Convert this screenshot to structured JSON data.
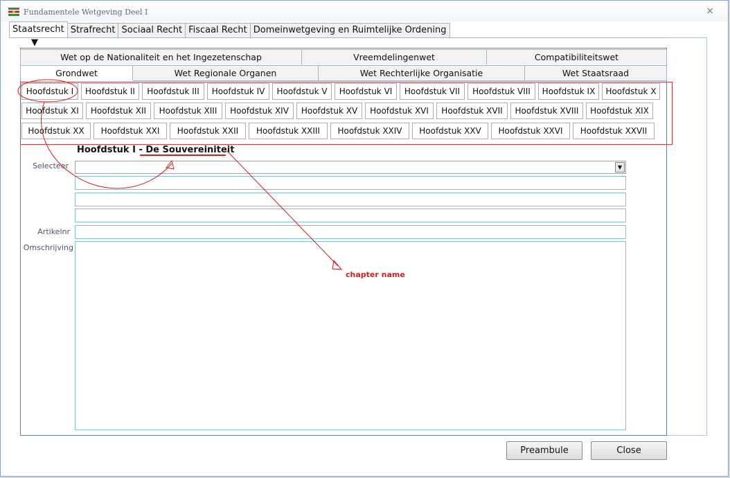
{
  "window": {
    "title": "Fundamentele Wetgeving Deel I"
  },
  "outer_tabs": [
    "Staatsrecht",
    "Strafrecht",
    "Sociaal Recht",
    "Fiscaal Recht",
    "Domeinwetgeving en Ruimtelijke Ordening"
  ],
  "inner_tabs_top": [
    "Wet op de Nationaliteit en het Ingezetenschap",
    "Vreemdelingenwet",
    "Compatibiliteitswet"
  ],
  "inner_tabs_bottom": [
    "Grondwet",
    "Wet Regionale Organen",
    "Wet Rechterlijke Organisatie",
    "Wet Staatsraad"
  ],
  "chapters_row1": [
    "Hoofdstuk I",
    "Hoofdstuk II",
    "Hoofdstuk III",
    "Hoofdstuk IV",
    "Hoofdstuk V",
    "Hoofdstuk VI",
    "Hoofdstuk VII",
    "Hoofdstuk VIII",
    "Hoofdstuk IX",
    "Hoofdstuk X"
  ],
  "chapters_row2": [
    "Hoofdstuk XI",
    "Hoofdstuk XII",
    "Hoofdstuk XIII",
    "Hoofdstuk XIV",
    "Hoofdstuk XV",
    "Hoofdstuk XVI",
    "Hoofdstuk XVII",
    "Hoofdstuk XVIII",
    "Hoofdstuk XIX"
  ],
  "chapters_row3": [
    "Hoofdstuk XX",
    "Hoofdstuk XXI",
    "Hoofdstuk XXII",
    "Hoofdstuk XXIII",
    "Hoofdstuk XXIV",
    "Hoofdstuk XXV",
    "Hoofdstuk XXVI",
    "Hoofdstuk XXVII"
  ],
  "heading": {
    "chapter": "Hoofdstuk I",
    "separator": "-",
    "name": "De Souvereiniteit"
  },
  "labels": {
    "select": "Selecteer",
    "article": "Artikelnr",
    "description": "Omschrijving"
  },
  "buttons": {
    "preamble": "Preambule",
    "close": "Close"
  },
  "annotation": {
    "text": "chapter name"
  },
  "colors": {
    "annotation": "#d02020",
    "field_border": "#86c0cf"
  }
}
